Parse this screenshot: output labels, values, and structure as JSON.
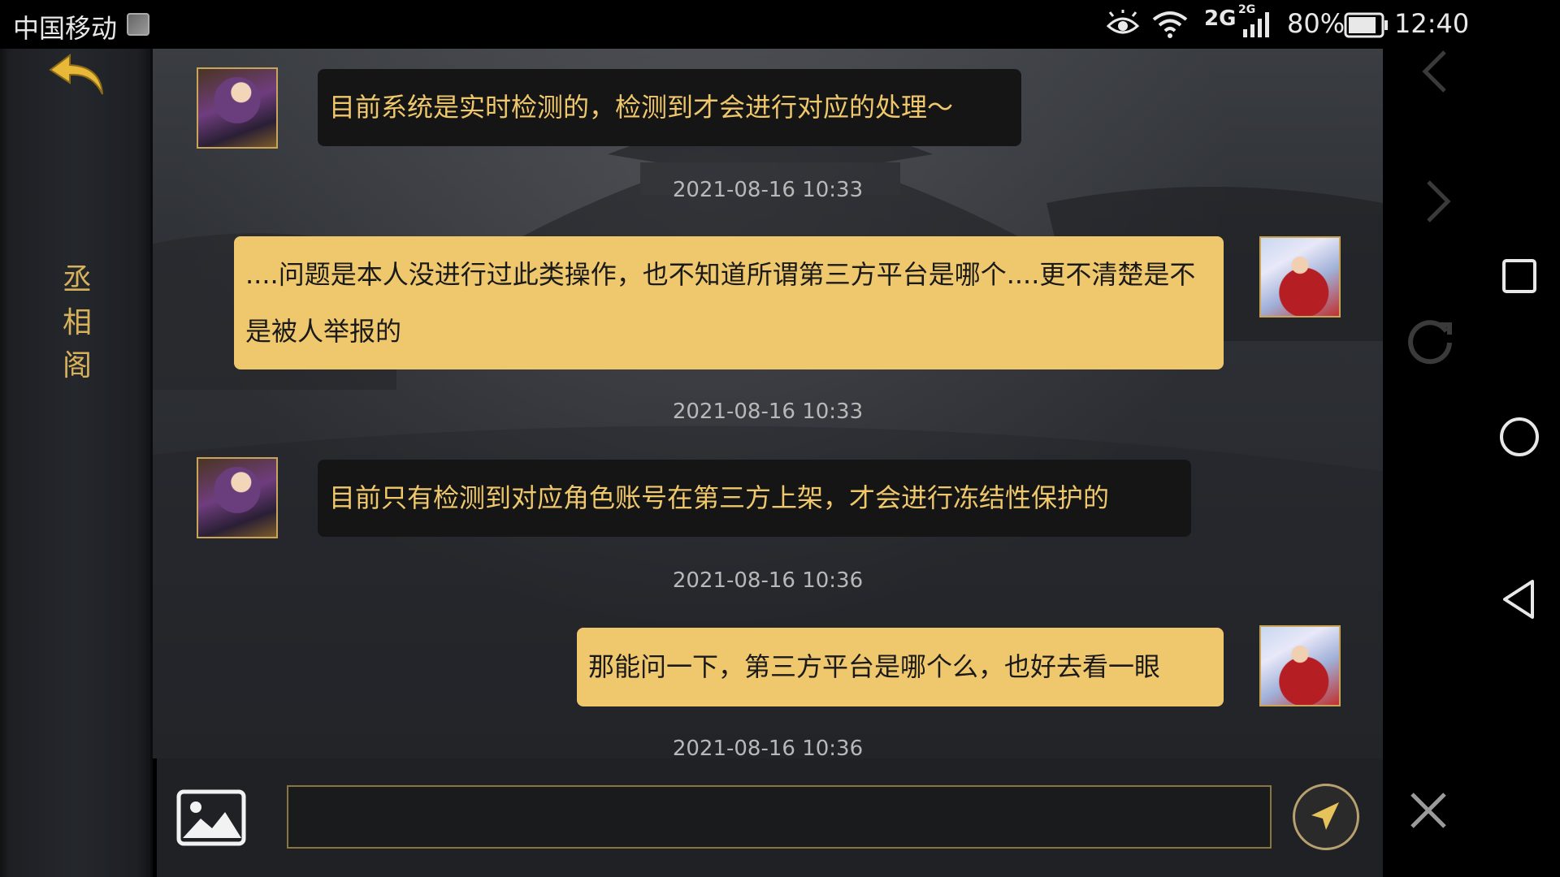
{
  "status_bar": {
    "carrier": "中国移动",
    "network": "2G",
    "network_small": "2G",
    "battery": "80%",
    "time": "12:40"
  },
  "sidebar": {
    "title_chars": [
      "丞",
      "相",
      "阁"
    ]
  },
  "messages": [
    {
      "sender": "npc",
      "text": "目前系统是实时检测的，检测到才会进行对应的处理～"
    },
    {
      "timestamp": "2021-08-16 10:33"
    },
    {
      "sender": "user",
      "text": "....问题是本人没进行过此类操作，也不知道所谓第三方平台是哪个....更不清楚是不是被人举报的"
    },
    {
      "timestamp": "2021-08-16 10:33"
    },
    {
      "sender": "npc",
      "text": "目前只有检测到对应角色账号在第三方上架，才会进行冻结性保护的"
    },
    {
      "timestamp": "2021-08-16 10:36"
    },
    {
      "sender": "user",
      "text": "那能问一下，第三方平台是哪个么，也好去看一眼"
    },
    {
      "timestamp": "2021-08-16 10:36"
    }
  ],
  "input": {
    "value": "",
    "placeholder": ""
  },
  "icons": {
    "back": "back-arrow-icon",
    "image": "image-icon",
    "send": "send-icon",
    "close": "close-icon"
  },
  "colors": {
    "accent_gold": "#efc76c",
    "npc_text": "#f0c86c",
    "npc_bubble": "#151515"
  }
}
